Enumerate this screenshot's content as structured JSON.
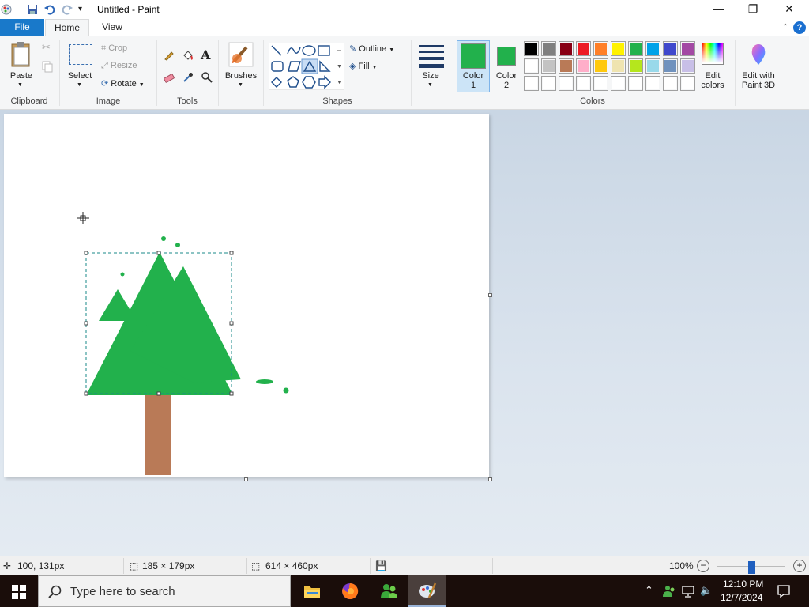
{
  "window": {
    "title": "Untitled - Paint"
  },
  "tabs": {
    "file": "File",
    "home": "Home",
    "view": "View"
  },
  "ribbon": {
    "clipboard": {
      "label": "Clipboard",
      "paste": "Paste"
    },
    "image": {
      "label": "Image",
      "select": "Select",
      "crop": "Crop",
      "resize": "Resize",
      "rotate": "Rotate"
    },
    "tools": {
      "label": "Tools"
    },
    "brushes": {
      "label": "Brushes"
    },
    "shapes": {
      "label": "Shapes",
      "outline": "Outline",
      "fill": "Fill"
    },
    "size": {
      "label": "Size"
    },
    "color1": {
      "line1": "Color",
      "line2": "1",
      "value": "#22b14c"
    },
    "color2": {
      "line1": "Color",
      "line2": "2",
      "value": "#22b14c"
    },
    "colors": {
      "label": "Colors",
      "row1": [
        "#000000",
        "#7f7f7f",
        "#880015",
        "#ed1c24",
        "#ff7f27",
        "#fff200",
        "#22b14c",
        "#00a2e8",
        "#3f48cc",
        "#a349a4"
      ],
      "row2": [
        "#ffffff",
        "#c3c3c3",
        "#b97a57",
        "#ffaec9",
        "#ffc90e",
        "#efe4b0",
        "#b5e61d",
        "#99d9ea",
        "#7092be",
        "#c8bfe7"
      ],
      "row3": [
        "#ffffff",
        "#ffffff",
        "#ffffff",
        "#ffffff",
        "#ffffff",
        "#ffffff",
        "#ffffff",
        "#ffffff",
        "#ffffff",
        "#ffffff"
      ]
    },
    "edit_colors": {
      "line1": "Edit",
      "line2": "colors"
    },
    "paint3d": {
      "line1": "Edit with",
      "line2": "Paint 3D"
    }
  },
  "drawing": {
    "tree_color": "#22b14c",
    "trunk_color": "#b97a57"
  },
  "status": {
    "cursor_pos": "100, 131px",
    "selection_size": "185 × 179px",
    "canvas_size": "614 × 460px",
    "zoom": "100%",
    "zoom_fraction": 0.5
  },
  "taskbar": {
    "search_placeholder": "Type here to search",
    "time": "12:10 PM",
    "date": "12/7/2024"
  }
}
